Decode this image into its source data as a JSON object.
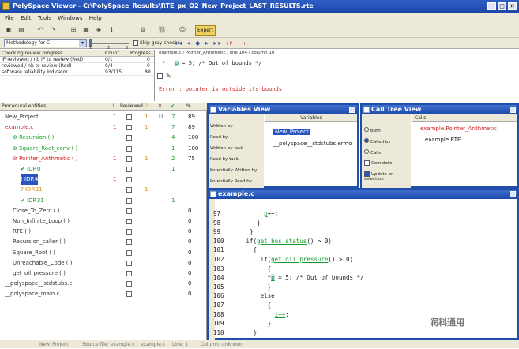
{
  "window": {
    "title": "PolySpace Viewer - C:\\PolySpace_Results\\RTE_px_O2_New_Project_LAST_RESULTS.rte",
    "btn_min": "_",
    "btn_max": "□",
    "btn_close": "✕"
  },
  "menu": [
    "File",
    "Edit",
    "Tools",
    "Windows",
    "Help"
  ],
  "toolbar": {
    "expert": "Expert",
    "icons": [
      "open-icon",
      "save-icon",
      "undo-icon",
      "redo-icon",
      "tree-icon",
      "image-icon",
      "filter-icon",
      "info-icon",
      "settings-icon",
      "link-icon"
    ]
  },
  "toolbar2": {
    "methodology": "Methodology for C",
    "ticks": [
      "1",
      "2",
      "3"
    ],
    "skip_gray": "Skip gray checks",
    "nav": "◂◂ ◂ ◆ ▸ ▸▸",
    "ip": "IP ++"
  },
  "review": {
    "headers": [
      "Checking review progress",
      "Count",
      "Progress"
    ],
    "rows": [
      [
        "IP reviewed / nb IP to review (Red)",
        "0/1",
        "0"
      ],
      [
        "reviewed / nb to review (Red)",
        "0/4",
        "0"
      ],
      [
        "software reliability indicator",
        "93/115",
        "80"
      ]
    ]
  },
  "preview": {
    "path": "example.c / Pointer_Arithmetic / line 104 / column 10",
    "code_prefix": "*",
    "code_hl": "p",
    "code_rest": " = 5; /* Out of bounds */",
    "error": "Error : pointer is outside its bounds"
  },
  "tree": {
    "headers": [
      "Procedural entities",
      "!",
      "Reviewed",
      "?",
      "✕",
      "✔",
      "%"
    ],
    "rows": [
      {
        "label": "New_Project",
        "color": "gray",
        "indent": 0,
        "red": "1",
        "orange": "1",
        "gray": "U",
        "green": "7",
        "pct": "89",
        "cb": true
      },
      {
        "label": "example.c",
        "color": "red",
        "indent": 0,
        "red": "1",
        "orange": "1",
        "gray": "",
        "green": "7",
        "pct": "89",
        "cb": true
      },
      {
        "label": "⊕ Recursion ( )",
        "color": "green",
        "indent": 1,
        "red": "",
        "orange": "",
        "gray": "",
        "green": "4",
        "pct": "100",
        "cb": true
      },
      {
        "label": "⊕ Square_Root_conv ( )",
        "color": "green",
        "indent": 1,
        "red": "",
        "orange": "",
        "gray": "",
        "green": "1",
        "pct": "100",
        "cb": true
      },
      {
        "label": "⊖ Pointer_Arithmetic ( )",
        "color": "red",
        "indent": 1,
        "red": "1",
        "orange": "1",
        "gray": "",
        "green": "2",
        "pct": "75",
        "cb": true
      },
      {
        "label": "✔ IDP.0",
        "color": "green",
        "indent": 2,
        "red": "",
        "orange": "",
        "gray": "",
        "green": "1",
        "pct": "",
        "cb": true
      },
      {
        "label": "! IDP.4",
        "color": "red",
        "indent": 2,
        "red": "1",
        "orange": "",
        "gray": "",
        "green": "",
        "pct": "",
        "cb": true
      },
      {
        "label": "? IDP.21",
        "color": "orange",
        "indent": 2,
        "red": "",
        "orange": "1",
        "gray": "",
        "green": "",
        "pct": "",
        "cb": true
      },
      {
        "label": "✔ IDP.31",
        "color": "green",
        "indent": 2,
        "red": "",
        "orange": "",
        "gray": "",
        "green": "1",
        "pct": "",
        "cb": true
      },
      {
        "label": "Close_To_Zero ( )",
        "color": "gray",
        "indent": 1,
        "red": "",
        "orange": "",
        "gray": "",
        "green": "",
        "pct": "0",
        "cb": true
      },
      {
        "label": "Non_Infinite_Loop ( )",
        "color": "gray",
        "indent": 1,
        "red": "",
        "orange": "",
        "gray": "",
        "green": "",
        "pct": "0",
        "cb": true
      },
      {
        "label": "RTE ( )",
        "color": "gray",
        "indent": 1,
        "red": "",
        "orange": "",
        "gray": "",
        "green": "",
        "pct": "0",
        "cb": true
      },
      {
        "label": "Recursion_caller ( )",
        "color": "gray",
        "indent": 1,
        "red": "",
        "orange": "",
        "gray": "",
        "green": "",
        "pct": "0",
        "cb": true
      },
      {
        "label": "Square_Root ( )",
        "color": "gray",
        "indent": 1,
        "red": "",
        "orange": "",
        "gray": "",
        "green": "",
        "pct": "0",
        "cb": true
      },
      {
        "label": "Unreachable_Code ( )",
        "color": "gray",
        "indent": 1,
        "red": "",
        "orange": "",
        "gray": "",
        "green": "",
        "pct": "0",
        "cb": true
      },
      {
        "label": "get_oil_pressure ( )",
        "color": "gray",
        "indent": 1,
        "red": "",
        "orange": "",
        "gray": "",
        "green": "",
        "pct": "0",
        "cb": true
      },
      {
        "label": "__polyspace__stdstubs.c",
        "color": "gray",
        "indent": 0,
        "red": "",
        "orange": "",
        "gray": "",
        "green": "",
        "pct": "0",
        "cb": true
      },
      {
        "label": "__polyspace_main.c",
        "color": "gray",
        "indent": 0,
        "red": "",
        "orange": "",
        "gray": "",
        "green": "",
        "pct": "0",
        "cb": true
      }
    ]
  },
  "variables": {
    "title": "Variables View",
    "options": [
      "Written by",
      "Read by",
      "Written by task",
      "Read by task",
      "Potentially Written by",
      "Potentially Read by"
    ],
    "column": "Variables",
    "items": [
      "New_Project",
      "__polyspace__stdstubs.ermo"
    ]
  },
  "calltree": {
    "title": "Call Tree View",
    "options": [
      "Both",
      "Called by",
      "Calls",
      "Complete",
      "Update on selection"
    ],
    "column": "Calls",
    "items": [
      "example.Pointer_Arithmetic",
      "example.RTE"
    ]
  },
  "code": {
    "title": "example.c",
    "lines": [
      {
        "n": "97",
        "pre": "        ",
        "u": "p",
        "post": "++;"
      },
      {
        "n": "98",
        "pre": "      }",
        "u": "",
        "post": ""
      },
      {
        "n": "99",
        "pre": "    }",
        "u": "",
        "post": ""
      },
      {
        "n": "100",
        "pre": "   if(",
        "u": "get bus status",
        "post": "() > 0)"
      },
      {
        "n": "101",
        "pre": "     {",
        "u": "",
        "post": ""
      },
      {
        "n": "102",
        "pre": "       if(",
        "u": "get oil pressure",
        "post": "() > 0)"
      },
      {
        "n": "103",
        "pre": "         {",
        "u": "",
        "post": ""
      },
      {
        "n": "104",
        "pre": "         *",
        "u": "p",
        "post": " = 5; /* Out of bounds */",
        "hl": true
      },
      {
        "n": "105",
        "pre": "         }",
        "u": "",
        "post": ""
      },
      {
        "n": "106",
        "pre": "       else",
        "u": "",
        "post": ""
      },
      {
        "n": "107",
        "pre": "         {",
        "u": "",
        "post": ""
      },
      {
        "n": "108",
        "pre": "           ",
        "u": "i++",
        "post": ";"
      },
      {
        "n": "109",
        "pre": "         }",
        "u": "",
        "post": ""
      },
      {
        "n": "110",
        "pre": "     }",
        "u": "",
        "post": ""
      }
    ]
  },
  "status": {
    "items": [
      "New_Project",
      "Source file: example.c",
      "example.c",
      "Line: 1",
      "Column: unknown"
    ]
  },
  "watermark": "润科通用"
}
